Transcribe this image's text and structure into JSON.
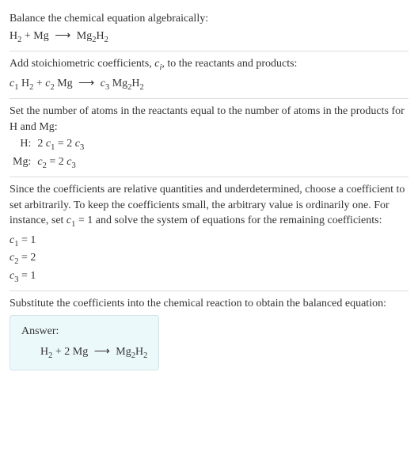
{
  "step1": {
    "intro": "Balance the chemical equation algebraically:",
    "eq_h2": "H",
    "eq_plus1": " + Mg ",
    "eq_arrow": "⟶",
    "eq_prod": " Mg",
    "eq_prod_h": "H"
  },
  "step2": {
    "intro_a": "Add stoichiometric coefficients, ",
    "intro_b": ", to the reactants and products:",
    "ci_c": "c",
    "ci_i": "i",
    "c1": "c",
    "c1s": "1",
    "h2": " H",
    "plus": " + ",
    "c2": "c",
    "c2s": "2",
    "mg": " Mg ",
    "arrow": "⟶",
    "sp": " ",
    "c3": "c",
    "c3s": "3",
    "prod": " Mg",
    "prod_h": "H"
  },
  "step3": {
    "intro": "Set the number of atoms in the reactants equal to the number of atoms in the products for H and Mg:",
    "rowH_label": "H:",
    "rowH_two1": "2 ",
    "rowH_c1": "c",
    "rowH_c1s": "1",
    "rowH_eq": " = 2 ",
    "rowH_c3": "c",
    "rowH_c3s": "3",
    "rowMg_label": "Mg:",
    "rowMg_c2": "c",
    "rowMg_c2s": "2",
    "rowMg_eq": " = 2 ",
    "rowMg_c3": "c",
    "rowMg_c3s": "3"
  },
  "step4": {
    "intro_a": "Since the coefficients are relative quantities and underdetermined, choose a coefficient to set arbitrarily. To keep the coefficients small, the arbitrary value is ordinarily one. For instance, set ",
    "c1": "c",
    "c1s": "1",
    "intro_b": " = 1 and solve the system of equations for the remaining coefficients:",
    "line1_c": "c",
    "line1_s": "1",
    "line1_v": " = 1",
    "line2_c": "c",
    "line2_s": "2",
    "line2_v": " = 2",
    "line3_c": "c",
    "line3_s": "3",
    "line3_v": " = 1"
  },
  "step5": {
    "intro": "Substitute the coefficients into the chemical reaction to obtain the balanced equation:",
    "answer_label": "Answer:",
    "eq_h2": "H",
    "eq_mid": " + 2 Mg ",
    "eq_arrow": "⟶",
    "eq_prod": " Mg",
    "eq_prod_h": "H"
  },
  "two": "2"
}
